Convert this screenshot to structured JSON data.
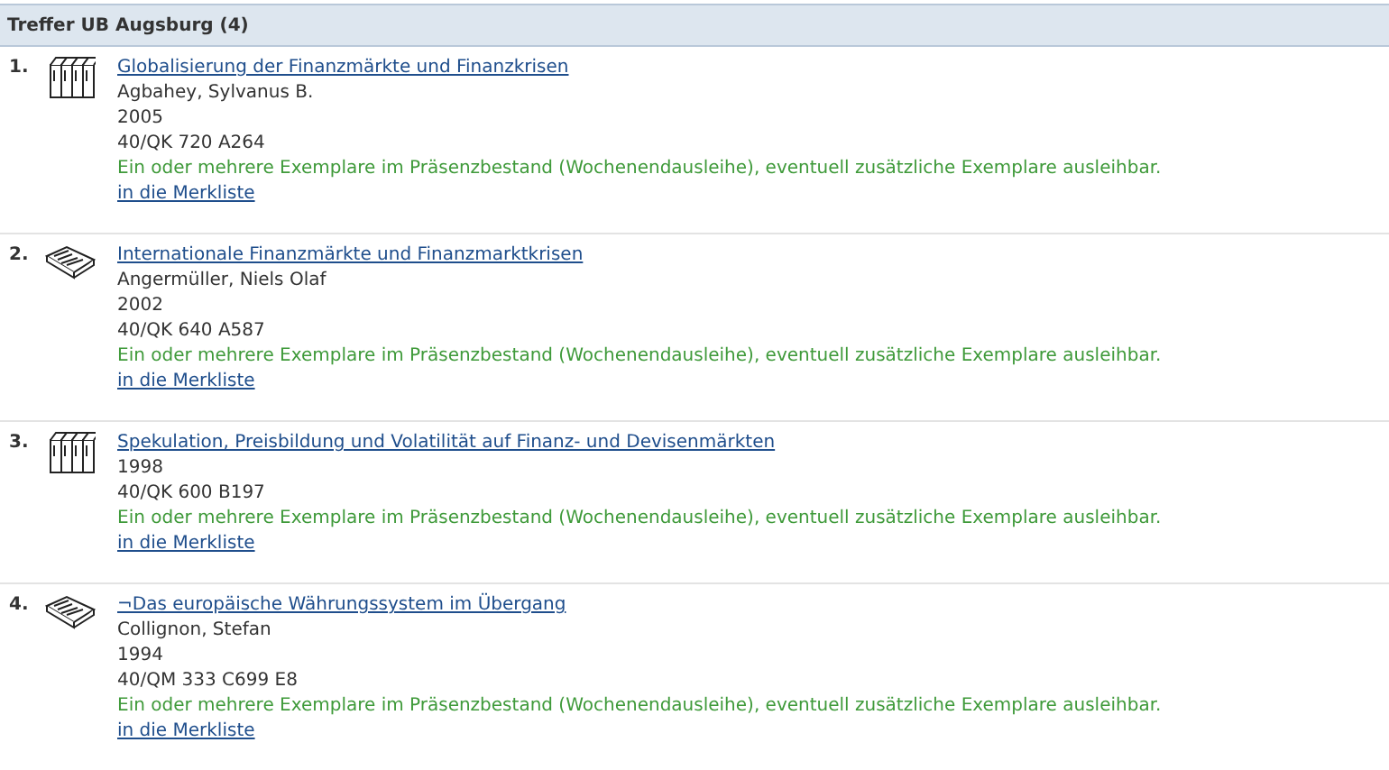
{
  "header": {
    "title": "Treffer UB Augsburg (4)"
  },
  "results": [
    {
      "number": "1.",
      "kind": "multivolume",
      "title": "Globalisierung der Finanzmärkte und Finanzkrisen",
      "author": "Agbahey, Sylvanus B.",
      "year": "2005",
      "signature": "40/QK 720 A264",
      "availability": "Ein oder mehrere Exemplare im Präsenzbestand (Wochenendausleihe), eventuell zusätzliche Exemplare ausleihbar.",
      "link": "in die Merkliste"
    },
    {
      "number": "2.",
      "kind": "book",
      "title": "Internationale Finanzmärkte und Finanzmarktkrisen",
      "author": "Angermüller, Niels Olaf",
      "year": "2002",
      "signature": "40/QK 640 A587",
      "availability": "Ein oder mehrere Exemplare im Präsenzbestand (Wochenendausleihe), eventuell zusätzliche Exemplare ausleihbar.",
      "link": "in die Merkliste"
    },
    {
      "number": "3.",
      "kind": "multivolume",
      "title": "Spekulation, Preisbildung und Volatilität auf Finanz- und Devisenmärkten",
      "year": "1998",
      "signature": "40/QK 600 B197",
      "availability": "Ein oder mehrere Exemplare im Präsenzbestand (Wochenendausleihe), eventuell zusätzliche Exemplare ausleihbar.",
      "link": "in die Merkliste"
    },
    {
      "number": "4.",
      "kind": "book",
      "title": "¬Das europäische Währungssystem im Übergang",
      "author": "Collignon, Stefan",
      "year": "1994",
      "signature": "40/QM 333 C699 E8",
      "availability": "Ein oder mehrere Exemplare im Präsenzbestand (Wochenendausleihe), eventuell zusätzliche Exemplare ausleihbar.",
      "link": "in die Merkliste"
    }
  ]
}
